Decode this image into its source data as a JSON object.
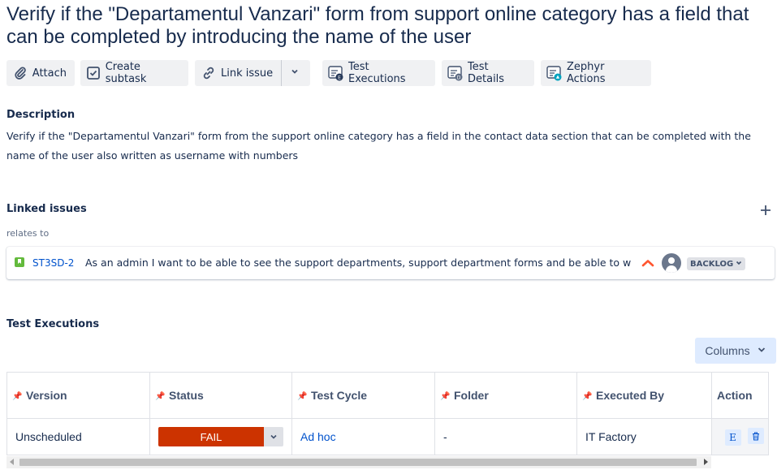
{
  "issue": {
    "title": "Verify if the \"Departamentul Vanzari\" form from support online category has a field that can be completed by introducing the name of the user"
  },
  "toolbar": {
    "attach": "Attach",
    "create_subtask": "Create subtask",
    "link_issue": "Link issue",
    "test_executions": "Test Executions",
    "test_details": "Test Details",
    "zephyr_actions": "Zephyr Actions"
  },
  "description": {
    "heading": "Description",
    "text": "Verify if the \"Departamentul Vanzari\" form from the support online category has a field in the contact data section that can be completed with the name of the user also written as username with numbers"
  },
  "linked_issues": {
    "heading": "Linked issues",
    "relation": "relates to",
    "items": [
      {
        "key": "ST3SD-2",
        "summary": "As an admin I want to be able to see the support departments, support department forms and be able to w...",
        "status": "BACKLOG",
        "priority_icon": "priority-high-icon"
      }
    ]
  },
  "test_executions": {
    "heading": "Test Executions",
    "columns_button": "Columns",
    "headers": [
      "Version",
      "Status",
      "Test Cycle",
      "Folder",
      "Executed By",
      "Action"
    ],
    "rows": [
      {
        "version": "Unscheduled",
        "status": "FAIL",
        "test_cycle": "Ad hoc",
        "folder": "-",
        "executed_by": "IT Factory",
        "action_execute": "E"
      }
    ]
  },
  "colors": {
    "fail": "#cc3300",
    "link": "#0052cc",
    "story": "#63ba3c",
    "columns_button_bg": "#deebff"
  }
}
